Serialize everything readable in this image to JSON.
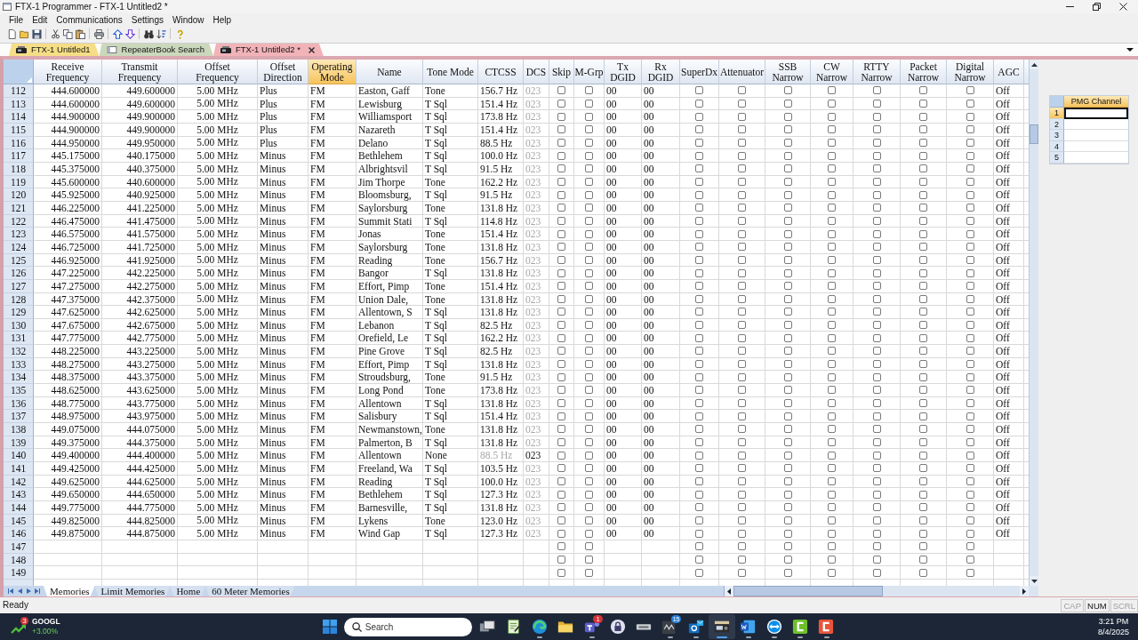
{
  "window": {
    "title": "FTX-1 Programmer - FTX-1 Untitled2 *"
  },
  "menu": [
    "File",
    "Edit",
    "Communications",
    "Settings",
    "Window",
    "Help"
  ],
  "tabs": [
    {
      "label": "FTX-1 Untitled1",
      "kind": "radio",
      "selected": false,
      "color": "#f6de86"
    },
    {
      "label": "RepeaterBook Search",
      "kind": "browser",
      "selected": false,
      "color": "#cbd8bc"
    },
    {
      "label": "FTX-1 Untitled2 *",
      "kind": "radio",
      "selected": true,
      "color": "#f1b3b8"
    }
  ],
  "table": {
    "columns": [
      {
        "label": "Receive\nFrequency",
        "kind": "text",
        "selected": false
      },
      {
        "label": "Transmit\nFrequency",
        "kind": "text",
        "selected": false
      },
      {
        "label": "Offset\nFrequency",
        "kind": "text",
        "selected": false
      },
      {
        "label": "Offset\nDirection",
        "kind": "text",
        "selected": false
      },
      {
        "label": "Operating\nMode",
        "kind": "text",
        "selected": true
      },
      {
        "label": "Name",
        "kind": "text",
        "selected": false
      },
      {
        "label": "Tone Mode",
        "kind": "text",
        "selected": false
      },
      {
        "label": "CTCSS",
        "kind": "text",
        "selected": false
      },
      {
        "label": "DCS",
        "kind": "text",
        "selected": false
      },
      {
        "label": "Skip",
        "kind": "check",
        "selected": false
      },
      {
        "label": "M-Grp",
        "kind": "check",
        "selected": false
      },
      {
        "label": "Tx\nDGID",
        "kind": "text",
        "selected": false
      },
      {
        "label": "Rx\nDGID",
        "kind": "text",
        "selected": false
      },
      {
        "label": "SuperDx",
        "kind": "check",
        "selected": false
      },
      {
        "label": "Attenuator",
        "kind": "check",
        "selected": false
      },
      {
        "label": "SSB\nNarrow",
        "kind": "check",
        "selected": false
      },
      {
        "label": "CW\nNarrow",
        "kind": "check",
        "selected": false
      },
      {
        "label": "RTTY\nNarrow",
        "kind": "check",
        "selected": false
      },
      {
        "label": "Packet\nNarrow",
        "kind": "check",
        "selected": false
      },
      {
        "label": "Digital\nNarrow",
        "kind": "check",
        "selected": false
      },
      {
        "label": "AGC",
        "kind": "text",
        "selected": false
      }
    ],
    "rows": [
      {
        "number": "112",
        "cells": [
          "444.600000",
          "449.600000",
          "5.00 MHz",
          "Plus",
          "FM",
          "Easton, Gaff",
          "Tone",
          "156.7 Hz",
          "023",
          "00",
          "00",
          "Off"
        ],
        "ctcss_disabled": false,
        "dcs_disabled": true,
        "checked": [
          false,
          false,
          false,
          false,
          false,
          false,
          false,
          false,
          false
        ]
      },
      {
        "number": "113",
        "cells": [
          "444.600000",
          "449.600000",
          "5.00 MHz",
          "Plus",
          "FM",
          "Lewisburg",
          "T Sql",
          "151.4 Hz",
          "023",
          "00",
          "00",
          "Off"
        ],
        "ctcss_disabled": false,
        "dcs_disabled": true,
        "checked": [
          false,
          false,
          false,
          false,
          false,
          false,
          false,
          false,
          false
        ]
      },
      {
        "number": "114",
        "cells": [
          "444.900000",
          "449.900000",
          "5.00 MHz",
          "Plus",
          "FM",
          "Williamsport",
          "T Sql",
          "173.8 Hz",
          "023",
          "00",
          "00",
          "Off"
        ],
        "ctcss_disabled": false,
        "dcs_disabled": true,
        "checked": [
          false,
          false,
          false,
          false,
          false,
          false,
          false,
          false,
          false
        ]
      },
      {
        "number": "115",
        "cells": [
          "444.900000",
          "449.900000",
          "5.00 MHz",
          "Plus",
          "FM",
          "Nazareth",
          "T Sql",
          "151.4 Hz",
          "023",
          "00",
          "00",
          "Off"
        ],
        "ctcss_disabled": false,
        "dcs_disabled": true,
        "checked": [
          false,
          false,
          false,
          false,
          false,
          false,
          false,
          false,
          false
        ]
      },
      {
        "number": "116",
        "cells": [
          "444.950000",
          "449.950000",
          "5.00 MHz",
          "Plus",
          "FM",
          "Delano",
          "T Sql",
          "88.5 Hz",
          "023",
          "00",
          "00",
          "Off"
        ],
        "ctcss_disabled": false,
        "dcs_disabled": true,
        "checked": [
          false,
          false,
          false,
          false,
          false,
          false,
          false,
          false,
          false
        ]
      },
      {
        "number": "117",
        "cells": [
          "445.175000",
          "440.175000",
          "5.00 MHz",
          "Minus",
          "FM",
          "Bethlehem",
          "T Sql",
          "100.0 Hz",
          "023",
          "00",
          "00",
          "Off"
        ],
        "ctcss_disabled": false,
        "dcs_disabled": true,
        "checked": [
          false,
          false,
          false,
          false,
          false,
          false,
          false,
          false,
          false
        ]
      },
      {
        "number": "118",
        "cells": [
          "445.375000",
          "440.375000",
          "5.00 MHz",
          "Minus",
          "FM",
          "Albrightsvil",
          "T Sql",
          "91.5 Hz",
          "023",
          "00",
          "00",
          "Off"
        ],
        "ctcss_disabled": false,
        "dcs_disabled": true,
        "checked": [
          false,
          false,
          false,
          false,
          false,
          false,
          false,
          false,
          false
        ]
      },
      {
        "number": "119",
        "cells": [
          "445.600000",
          "440.600000",
          "5.00 MHz",
          "Minus",
          "FM",
          "Jim Thorpe",
          "Tone",
          "162.2 Hz",
          "023",
          "00",
          "00",
          "Off"
        ],
        "ctcss_disabled": false,
        "dcs_disabled": true,
        "checked": [
          false,
          false,
          false,
          false,
          false,
          false,
          false,
          false,
          false
        ]
      },
      {
        "number": "120",
        "cells": [
          "445.925000",
          "440.925000",
          "5.00 MHz",
          "Minus",
          "FM",
          "Bloomsburg,",
          "T Sql",
          "91.5 Hz",
          "023",
          "00",
          "00",
          "Off"
        ],
        "ctcss_disabled": false,
        "dcs_disabled": true,
        "checked": [
          false,
          false,
          false,
          false,
          false,
          false,
          false,
          false,
          false
        ]
      },
      {
        "number": "121",
        "cells": [
          "446.225000",
          "441.225000",
          "5.00 MHz",
          "Minus",
          "FM",
          "Saylorsburg",
          "Tone",
          "131.8 Hz",
          "023",
          "00",
          "00",
          "Off"
        ],
        "ctcss_disabled": false,
        "dcs_disabled": true,
        "checked": [
          false,
          false,
          false,
          false,
          false,
          false,
          false,
          false,
          false
        ]
      },
      {
        "number": "122",
        "cells": [
          "446.475000",
          "441.475000",
          "5.00 MHz",
          "Minus",
          "FM",
          "Summit Stati",
          "T Sql",
          "114.8 Hz",
          "023",
          "00",
          "00",
          "Off"
        ],
        "ctcss_disabled": false,
        "dcs_disabled": true,
        "checked": [
          false,
          false,
          false,
          false,
          false,
          false,
          false,
          false,
          false
        ]
      },
      {
        "number": "123",
        "cells": [
          "446.575000",
          "441.575000",
          "5.00 MHz",
          "Minus",
          "FM",
          "Jonas",
          "Tone",
          "151.4 Hz",
          "023",
          "00",
          "00",
          "Off"
        ],
        "ctcss_disabled": false,
        "dcs_disabled": true,
        "checked": [
          false,
          false,
          false,
          false,
          false,
          false,
          false,
          false,
          false
        ]
      },
      {
        "number": "124",
        "cells": [
          "446.725000",
          "441.725000",
          "5.00 MHz",
          "Minus",
          "FM",
          "Saylorsburg",
          "Tone",
          "131.8 Hz",
          "023",
          "00",
          "00",
          "Off"
        ],
        "ctcss_disabled": false,
        "dcs_disabled": true,
        "checked": [
          false,
          false,
          false,
          false,
          false,
          false,
          false,
          false,
          false
        ]
      },
      {
        "number": "125",
        "cells": [
          "446.925000",
          "441.925000",
          "5.00 MHz",
          "Minus",
          "FM",
          "Reading",
          "Tone",
          "156.7 Hz",
          "023",
          "00",
          "00",
          "Off"
        ],
        "ctcss_disabled": false,
        "dcs_disabled": true,
        "checked": [
          false,
          false,
          false,
          false,
          false,
          false,
          false,
          false,
          false
        ]
      },
      {
        "number": "126",
        "cells": [
          "447.225000",
          "442.225000",
          "5.00 MHz",
          "Minus",
          "FM",
          "Bangor",
          "T Sql",
          "131.8 Hz",
          "023",
          "00",
          "00",
          "Off"
        ],
        "ctcss_disabled": false,
        "dcs_disabled": true,
        "checked": [
          false,
          false,
          false,
          false,
          false,
          false,
          false,
          false,
          false
        ]
      },
      {
        "number": "127",
        "cells": [
          "447.275000",
          "442.275000",
          "5.00 MHz",
          "Minus",
          "FM",
          "Effort, Pimp",
          "Tone",
          "151.4 Hz",
          "023",
          "00",
          "00",
          "Off"
        ],
        "ctcss_disabled": false,
        "dcs_disabled": true,
        "checked": [
          false,
          false,
          false,
          false,
          false,
          false,
          false,
          false,
          false
        ]
      },
      {
        "number": "128",
        "cells": [
          "447.375000",
          "442.375000",
          "5.00 MHz",
          "Minus",
          "FM",
          "Union Dale,",
          "Tone",
          "131.8 Hz",
          "023",
          "00",
          "00",
          "Off"
        ],
        "ctcss_disabled": false,
        "dcs_disabled": true,
        "checked": [
          false,
          false,
          false,
          false,
          false,
          false,
          false,
          false,
          false
        ]
      },
      {
        "number": "129",
        "cells": [
          "447.625000",
          "442.625000",
          "5.00 MHz",
          "Minus",
          "FM",
          "Allentown, S",
          "T Sql",
          "131.8 Hz",
          "023",
          "00",
          "00",
          "Off"
        ],
        "ctcss_disabled": false,
        "dcs_disabled": true,
        "checked": [
          false,
          false,
          false,
          false,
          false,
          false,
          false,
          false,
          false
        ]
      },
      {
        "number": "130",
        "cells": [
          "447.675000",
          "442.675000",
          "5.00 MHz",
          "Minus",
          "FM",
          "Lebanon",
          "T Sql",
          "82.5 Hz",
          "023",
          "00",
          "00",
          "Off"
        ],
        "ctcss_disabled": false,
        "dcs_disabled": true,
        "checked": [
          false,
          false,
          false,
          false,
          false,
          false,
          false,
          false,
          false
        ]
      },
      {
        "number": "131",
        "cells": [
          "447.775000",
          "442.775000",
          "5.00 MHz",
          "Minus",
          "FM",
          "Orefield, Le",
          "T Sql",
          "162.2 Hz",
          "023",
          "00",
          "00",
          "Off"
        ],
        "ctcss_disabled": false,
        "dcs_disabled": true,
        "checked": [
          false,
          false,
          false,
          false,
          false,
          false,
          false,
          false,
          false
        ]
      },
      {
        "number": "132",
        "cells": [
          "448.225000",
          "443.225000",
          "5.00 MHz",
          "Minus",
          "FM",
          "Pine Grove",
          "T Sql",
          "82.5 Hz",
          "023",
          "00",
          "00",
          "Off"
        ],
        "ctcss_disabled": false,
        "dcs_disabled": true,
        "checked": [
          false,
          false,
          false,
          false,
          false,
          false,
          false,
          false,
          false
        ]
      },
      {
        "number": "133",
        "cells": [
          "448.275000",
          "443.275000",
          "5.00 MHz",
          "Minus",
          "FM",
          "Effort, Pimp",
          "T Sql",
          "131.8 Hz",
          "023",
          "00",
          "00",
          "Off"
        ],
        "ctcss_disabled": false,
        "dcs_disabled": true,
        "checked": [
          false,
          false,
          false,
          false,
          false,
          false,
          false,
          false,
          false
        ]
      },
      {
        "number": "134",
        "cells": [
          "448.375000",
          "443.375000",
          "5.00 MHz",
          "Minus",
          "FM",
          "Stroudsburg,",
          "Tone",
          "91.5 Hz",
          "023",
          "00",
          "00",
          "Off"
        ],
        "ctcss_disabled": false,
        "dcs_disabled": true,
        "checked": [
          false,
          false,
          false,
          false,
          false,
          false,
          false,
          false,
          false
        ]
      },
      {
        "number": "135",
        "cells": [
          "448.625000",
          "443.625000",
          "5.00 MHz",
          "Minus",
          "FM",
          "Long Pond",
          "Tone",
          "173.8 Hz",
          "023",
          "00",
          "00",
          "Off"
        ],
        "ctcss_disabled": false,
        "dcs_disabled": true,
        "checked": [
          false,
          false,
          false,
          false,
          false,
          false,
          false,
          false,
          false
        ]
      },
      {
        "number": "136",
        "cells": [
          "448.775000",
          "443.775000",
          "5.00 MHz",
          "Minus",
          "FM",
          "Allentown",
          "T Sql",
          "131.8 Hz",
          "023",
          "00",
          "00",
          "Off"
        ],
        "ctcss_disabled": false,
        "dcs_disabled": true,
        "checked": [
          false,
          false,
          false,
          false,
          false,
          false,
          false,
          false,
          false
        ]
      },
      {
        "number": "137",
        "cells": [
          "448.975000",
          "443.975000",
          "5.00 MHz",
          "Minus",
          "FM",
          "Salisbury",
          "T Sql",
          "151.4 Hz",
          "023",
          "00",
          "00",
          "Off"
        ],
        "ctcss_disabled": false,
        "dcs_disabled": true,
        "checked": [
          false,
          false,
          false,
          false,
          false,
          false,
          false,
          false,
          false
        ]
      },
      {
        "number": "138",
        "cells": [
          "449.075000",
          "444.075000",
          "5.00 MHz",
          "Minus",
          "FM",
          "Newmanstown,",
          "Tone",
          "131.8 Hz",
          "023",
          "00",
          "00",
          "Off"
        ],
        "ctcss_disabled": false,
        "dcs_disabled": true,
        "checked": [
          false,
          false,
          false,
          false,
          false,
          false,
          false,
          false,
          false
        ]
      },
      {
        "number": "139",
        "cells": [
          "449.375000",
          "444.375000",
          "5.00 MHz",
          "Minus",
          "FM",
          "Palmerton, B",
          "T Sql",
          "131.8 Hz",
          "023",
          "00",
          "00",
          "Off"
        ],
        "ctcss_disabled": false,
        "dcs_disabled": true,
        "checked": [
          false,
          false,
          false,
          false,
          false,
          false,
          false,
          false,
          false
        ]
      },
      {
        "number": "140",
        "cells": [
          "449.400000",
          "444.400000",
          "5.00 MHz",
          "Minus",
          "FM",
          "Allentown",
          "None",
          "88.5 Hz",
          "023",
          "00",
          "00",
          "Off"
        ],
        "ctcss_disabled": true,
        "dcs_disabled": false,
        "checked": [
          false,
          false,
          false,
          false,
          false,
          false,
          false,
          false,
          false
        ]
      },
      {
        "number": "141",
        "cells": [
          "449.425000",
          "444.425000",
          "5.00 MHz",
          "Minus",
          "FM",
          "Freeland, Wa",
          "T Sql",
          "103.5 Hz",
          "023",
          "00",
          "00",
          "Off"
        ],
        "ctcss_disabled": false,
        "dcs_disabled": true,
        "checked": [
          false,
          false,
          false,
          false,
          false,
          false,
          false,
          false,
          false
        ]
      },
      {
        "number": "142",
        "cells": [
          "449.625000",
          "444.625000",
          "5.00 MHz",
          "Minus",
          "FM",
          "Reading",
          "T Sql",
          "100.0 Hz",
          "023",
          "00",
          "00",
          "Off"
        ],
        "ctcss_disabled": false,
        "dcs_disabled": true,
        "checked": [
          false,
          false,
          false,
          false,
          false,
          false,
          false,
          false,
          false
        ]
      },
      {
        "number": "143",
        "cells": [
          "449.650000",
          "444.650000",
          "5.00 MHz",
          "Minus",
          "FM",
          "Bethlehem",
          "T Sql",
          "127.3 Hz",
          "023",
          "00",
          "00",
          "Off"
        ],
        "ctcss_disabled": false,
        "dcs_disabled": true,
        "checked": [
          false,
          false,
          false,
          false,
          false,
          false,
          false,
          false,
          false
        ]
      },
      {
        "number": "144",
        "cells": [
          "449.775000",
          "444.775000",
          "5.00 MHz",
          "Minus",
          "FM",
          "Barnesville,",
          "T Sql",
          "131.8 Hz",
          "023",
          "00",
          "00",
          "Off"
        ],
        "ctcss_disabled": false,
        "dcs_disabled": true,
        "checked": [
          false,
          false,
          false,
          false,
          false,
          false,
          false,
          false,
          false
        ]
      },
      {
        "number": "145",
        "cells": [
          "449.825000",
          "444.825000",
          "5.00 MHz",
          "Minus",
          "FM",
          "Lykens",
          "Tone",
          "123.0 Hz",
          "023",
          "00",
          "00",
          "Off"
        ],
        "ctcss_disabled": false,
        "dcs_disabled": true,
        "checked": [
          false,
          false,
          false,
          false,
          false,
          false,
          false,
          false,
          false
        ]
      },
      {
        "number": "146",
        "cells": [
          "449.875000",
          "444.875000",
          "5.00 MHz",
          "Minus",
          "FM",
          "Wind Gap",
          "T Sql",
          "127.3 Hz",
          "023",
          "00",
          "00",
          "Off"
        ],
        "ctcss_disabled": false,
        "dcs_disabled": true,
        "checked": [
          false,
          false,
          false,
          false,
          false,
          false,
          false,
          false,
          false
        ]
      },
      {
        "number": "147",
        "checked": [
          false,
          false,
          false,
          false,
          false,
          false,
          false,
          false,
          false
        ]
      },
      {
        "number": "148",
        "checked": [
          false,
          false,
          false,
          false,
          false,
          false,
          false,
          false,
          false
        ]
      },
      {
        "number": "149",
        "checked": [
          false,
          false,
          false,
          false,
          false,
          false,
          false,
          false,
          false
        ]
      }
    ]
  },
  "sheet_tabs": [
    {
      "label": "Memories",
      "selected": true
    },
    {
      "label": "Limit Memories",
      "selected": false
    },
    {
      "label": "Home",
      "selected": false
    },
    {
      "label": "60 Meter Memories",
      "selected": false
    }
  ],
  "pmg": {
    "title": "PMG Channel",
    "rows": [
      {
        "number": "1",
        "selected": true
      },
      {
        "number": "2",
        "selected": false
      },
      {
        "number": "3",
        "selected": false
      },
      {
        "number": "4",
        "selected": false
      },
      {
        "number": "5",
        "selected": false
      }
    ]
  },
  "status_bar": {
    "text": "Ready",
    "indicators": [
      {
        "label": "CAP",
        "on": false
      },
      {
        "label": "NUM",
        "on": true
      },
      {
        "label": "SCRL",
        "on": false
      }
    ]
  },
  "taskbar": {
    "widget": {
      "badge": "3",
      "ticker": "GOOGL",
      "change": "+3.00%"
    },
    "search": {
      "placeholder": "Search"
    },
    "apps": [
      {
        "running": false,
        "selected": false
      },
      {
        "running": false,
        "selected": false
      },
      {
        "running": true,
        "selected": false
      },
      {
        "running": false,
        "selected": false
      },
      {
        "badge": "1",
        "running": true,
        "selected": false
      },
      {
        "running": false,
        "selected": false
      },
      {
        "running": false,
        "selected": false
      },
      {
        "badge": "15",
        "running": true,
        "selected": false
      },
      {
        "running": true,
        "selected": false
      },
      {
        "running": true,
        "selected": true
      },
      {
        "running": true,
        "selected": false
      },
      {
        "running": true,
        "selected": false
      },
      {
        "running": true,
        "selected": false
      },
      {
        "running": true,
        "selected": false
      }
    ],
    "clock": {
      "time": "3:21 PM",
      "date": "8/4/2025"
    }
  }
}
